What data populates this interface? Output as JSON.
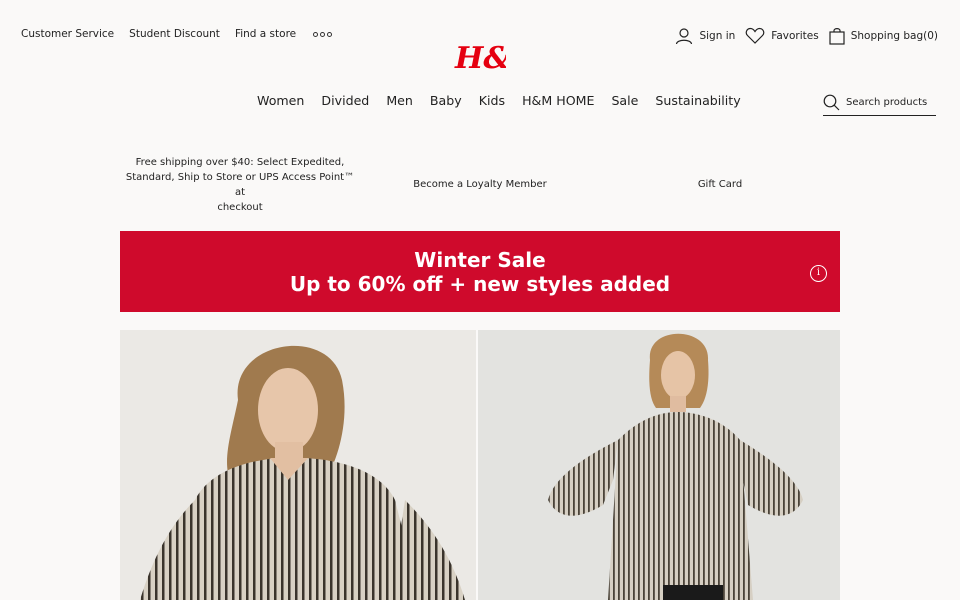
{
  "utility_links": [
    "Customer Service",
    "Student Discount",
    "Find a store"
  ],
  "logo": {
    "text": "H&M",
    "color": "#e50010"
  },
  "account": {
    "sign_in": "Sign in",
    "favorites": "Favorites",
    "bag": "Shopping bag(0)"
  },
  "nav": [
    "Women",
    "Divided",
    "Men",
    "Baby",
    "Kids",
    "H&M HOME",
    "Sale",
    "Sustainability"
  ],
  "search": {
    "placeholder": "Search products"
  },
  "info_strip": {
    "shipping_lines": [
      "Free shipping over $40: Select Expedited,",
      "Standard, Ship to Store or UPS Access Point™ at",
      "checkout"
    ],
    "loyalty": "Become a Loyalty Member",
    "gift_card": "Gift Card"
  },
  "banner": {
    "line1": "Winter Sale",
    "line2": "Up to 60% off + new styles added",
    "color": "#cf0a2c",
    "info_glyph": "i"
  },
  "hero": {
    "left_image": "model-striped-shirt-closeup",
    "right_image": "model-striped-shirt-full"
  }
}
